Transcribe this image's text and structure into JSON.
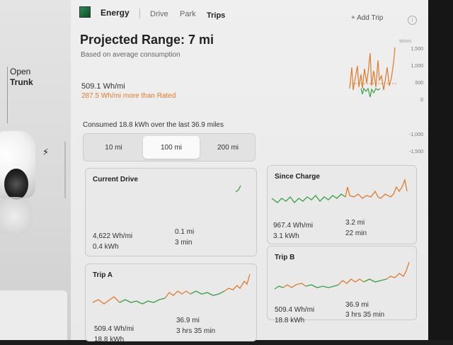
{
  "left": {
    "open_label": "Open",
    "trunk_label": "Trunk"
  },
  "tabs": {
    "energy": "Energy",
    "drive": "Drive",
    "park": "Park",
    "trips": "Trips",
    "add_trip": "+ Add Trip"
  },
  "header": {
    "title": "Projected Range: 7 mi",
    "subtitle": "Based on average consumption",
    "usage": "509.1 Wh/mi",
    "usage_diff": "287.5 Wh/mi more than Rated",
    "consumed": "Consumed 18.8 kWh over the last 36.9 miles"
  },
  "range_selector": {
    "options": [
      "10 mi",
      "100 mi",
      "200 mi"
    ],
    "selected": "100 mi"
  },
  "chart_data": {
    "type": "line",
    "ylabel": "Wh/mi",
    "yticks": [
      "1,500",
      "1,000",
      "500",
      "0",
      "-1,000",
      "-1,500"
    ],
    "ylim": [
      -1500,
      1500
    ]
  },
  "cards": {
    "current": {
      "title": "Current Drive",
      "efficiency": "4,622 Wh/mi",
      "energy": "0.4 kWh",
      "distance": "0.1 mi",
      "duration": "3 min"
    },
    "since_charge": {
      "title": "Since Charge",
      "efficiency": "967.4 Wh/mi",
      "energy": "3.1 kWh",
      "distance": "3.2 mi",
      "duration": "22 min"
    },
    "trip_a": {
      "title": "Trip A",
      "efficiency": "509.4 Wh/mi",
      "energy": "18.8 kWh",
      "distance": "36.9 mi",
      "duration": "3 hrs 35 min"
    },
    "trip_b": {
      "title": "Trip B",
      "efficiency": "509.4 Wh/mi",
      "energy": "18.8 kWh",
      "distance": "36.9 mi",
      "duration": "3 hrs 35 min"
    }
  },
  "colors": {
    "orange": "#e07b2a",
    "green": "#3aa046",
    "amber": "#d9a320"
  }
}
